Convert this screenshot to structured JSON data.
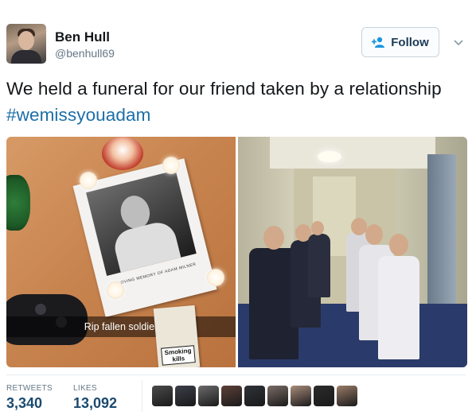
{
  "user": {
    "name": "Ben Hull",
    "handle": "@benhull69"
  },
  "follow_button": {
    "label": "Follow",
    "icon": "add-user-icon"
  },
  "menu_icon": "chevron-down-icon",
  "tweet": {
    "text": "We held a funeral for our friend taken by a relationship ",
    "hashtag": "#wemissyouadam"
  },
  "media": {
    "left": {
      "snap_caption": "Rip fallen soldier",
      "memorial_caption": "IN LOVING MEMORY OF ADAM MILNER",
      "pack_label": "Smoking kills"
    },
    "right": {}
  },
  "stats": {
    "retweets_label": "RETWEETS",
    "retweets_value": "3,340",
    "likes_label": "LIKES",
    "likes_value": "13,092"
  },
  "likers": [
    {
      "color": "#4a4a4a"
    },
    {
      "color": "#3b3f4a"
    },
    {
      "color": "#6b6b6b"
    },
    {
      "color": "#5c4038"
    },
    {
      "color": "#2f3238"
    },
    {
      "color": "#7a6c66"
    },
    {
      "color": "#a88c7a"
    },
    {
      "color": "#2b2b2b"
    },
    {
      "color": "#9a7c68"
    }
  ]
}
